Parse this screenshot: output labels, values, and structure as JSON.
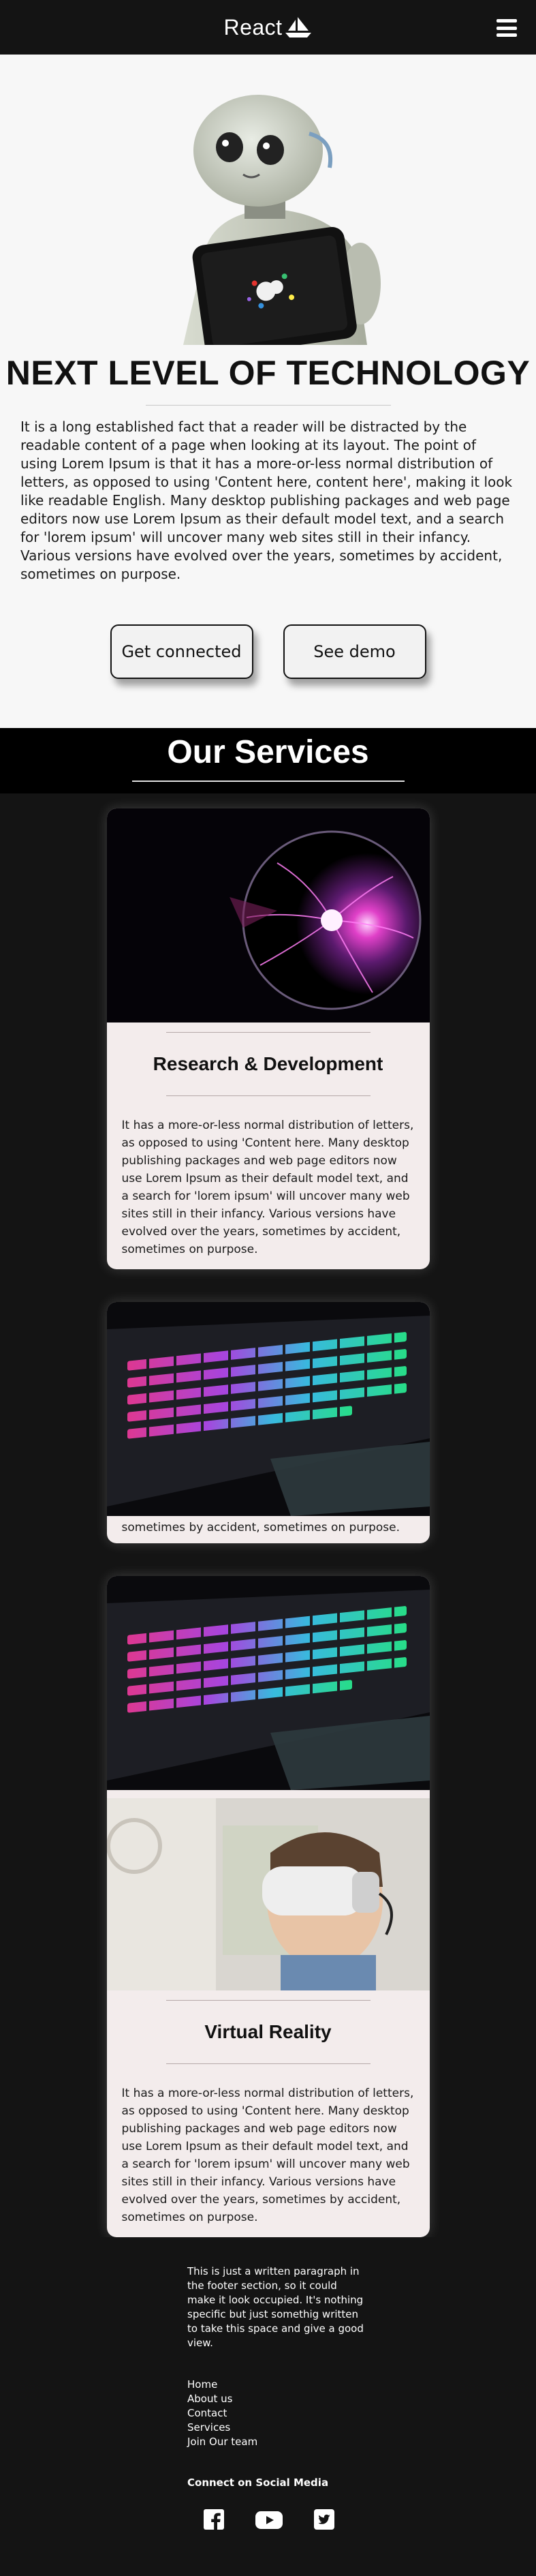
{
  "nav": {
    "brand": "React",
    "logo_icon": "boat-logo-icon",
    "menu_icon": "hamburger-menu-icon"
  },
  "hero": {
    "image": "humanoid-robot-with-tablet",
    "title": "NEXT LEVEL OF TECHNOLOGY",
    "text": "It is a long established fact that a reader will be distracted by the readable content of a page when looking at its layout. The point of using Lorem Ipsum is that it has a more-or-less normal distribution of letters, as opposed to using 'Content here, content here', making it look like readable English. Many desktop publishing packages and web page editors now use Lorem Ipsum as their default model text, and a search for 'lorem ipsum' will uncover many web sites still in their infancy. Various versions have evolved over the years, sometimes by accident, sometimes on purpose.",
    "buttons": {
      "connect": "Get connected",
      "demo": "See demo"
    }
  },
  "services": {
    "title": "Our Services",
    "cards": [
      {
        "image": "plasma-ball",
        "title": "Research & Development",
        "text": "It has a more-or-less normal distribution of letters, as opposed to using 'Content here. Many desktop publishing packages and web page editors now use Lorem Ipsum as their default model text, and a search for 'lorem ipsum' will uncover many web sites still in their infancy. Various versions have evolved over the years, sometimes by accident, sometimes on purpose."
      },
      {
        "image": "rgb-backlit-keyboard",
        "text_visible_lines": "Various versions have evolved over the years, sometimes by accident, sometimes on purpose."
      },
      {
        "image_top": "rgb-backlit-keyboard",
        "image": "child-with-vr-headset",
        "title": "Virtual Reality",
        "text": "It has a more-or-less normal distribution of letters, as opposed to using 'Content here. Many desktop publishing packages and web page editors now use Lorem Ipsum as their default model text, and a search for 'lorem ipsum' will uncover many web sites still in their infancy. Various versions have evolved over the years, sometimes by accident, sometimes on purpose."
      }
    ]
  },
  "footer": {
    "paragraph": "This is just a written paragraph in the footer section, so it could make it look occupied. It's nothing specific but just somethig written to take this space and give a good view.",
    "links": [
      "Home",
      "About us",
      "Contact",
      "Services",
      "Join Our team"
    ],
    "social_title": "Connect on Social Media",
    "social_icons": [
      "facebook-icon",
      "youtube-icon",
      "twitter-icon"
    ]
  }
}
